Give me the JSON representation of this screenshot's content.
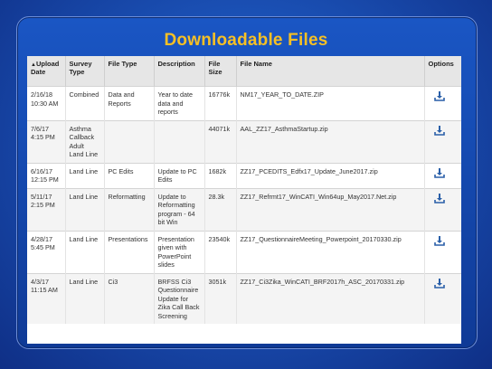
{
  "page": {
    "title": "Downloadable Files"
  },
  "table": {
    "headers": {
      "upload_date": "Upload Date",
      "survey_type": "Survey Type",
      "file_type": "File Type",
      "description": "Description",
      "file_size": "File Size",
      "file_name": "File Name",
      "options": "Options"
    },
    "sort_indicator": "▲",
    "rows": [
      {
        "date": "2/16/18 10:30 AM",
        "survey": "Combined",
        "type": "Data and Reports",
        "desc": "Year to date data and reports",
        "size": "16776k",
        "name": "NM17_YEAR_TO_DATE.ZIP"
      },
      {
        "date": "7/6/17 4:15 PM",
        "survey": "Asthma Callback Adult Land Line",
        "type": "",
        "desc": "",
        "size": "44071k",
        "name": "AAL_ZZ17_AsthmaStartup.zip"
      },
      {
        "date": "6/16/17 12:15 PM",
        "survey": "Land Line",
        "type": "PC Edits",
        "desc": "Update to PC Edits",
        "size": "1682k",
        "name": "ZZ17_PCEDITS_Edfx17_Update_June2017.zip"
      },
      {
        "date": "5/11/17 2:15 PM",
        "survey": "Land Line",
        "type": "Reformatting",
        "desc": "Update to Reformatting program - 64 bit Win",
        "size": "28.3k",
        "name": "ZZ17_Refrmt17_WinCATI_Win64up_May2017.Net.zip"
      },
      {
        "date": "4/28/17 5:45 PM",
        "survey": "Land Line",
        "type": "Presentations",
        "desc": "Presentation given with PowerPoint slides",
        "size": "23540k",
        "name": "ZZ17_QuestionnaireMeeting_Powerpoint_20170330.zip"
      },
      {
        "date": "4/3/17 11:15 AM",
        "survey": "Land Line",
        "type": "Ci3",
        "desc": "BRFSS Ci3 Questionnaire Update for Zika Call Back Screening",
        "size": "3051k",
        "name": "ZZ17_Ci3Zika_WinCATI_BRF2017h_ASC_20170331.zip"
      }
    ]
  }
}
